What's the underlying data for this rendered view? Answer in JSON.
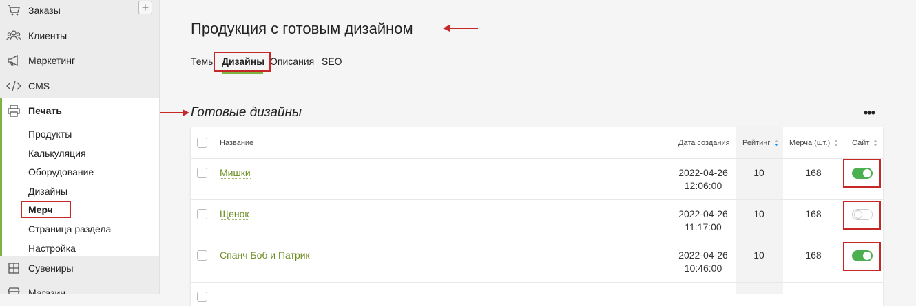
{
  "sidebar": {
    "items": [
      {
        "label": "Заказы",
        "icon": "cart-icon"
      },
      {
        "label": "Клиенты",
        "icon": "users-icon"
      },
      {
        "label": "Маркетинг",
        "icon": "megaphone-icon"
      },
      {
        "label": "CMS",
        "icon": "code-icon"
      },
      {
        "label": "Печать",
        "icon": "printer-icon"
      },
      {
        "label": "Сувениры",
        "icon": "box-icon"
      },
      {
        "label": "Магазин",
        "icon": "store-icon"
      }
    ],
    "add_label": "+",
    "print_subitems": [
      "Продукты",
      "Калькуляция",
      "Оборудование",
      "Дизайны",
      "Мерч",
      "Страница раздела",
      "Настройка"
    ]
  },
  "header": {
    "title": "Продукция с готовым дизайном"
  },
  "tabs": [
    "Темы",
    "Дизайны",
    "Описания",
    "SEO"
  ],
  "active_tab": "Дизайны",
  "section": {
    "title": "Готовые дизайны",
    "more_label": "•••"
  },
  "table": {
    "columns": [
      "Название",
      "Дата создания",
      "Рейтинг",
      "Мерча (шт.)",
      "Сайт"
    ],
    "rows": [
      {
        "name": "Мишки",
        "date": "2022-04-26",
        "time": "12:06:00",
        "rating": "10",
        "merch": "168",
        "site": true
      },
      {
        "name": "Щенок",
        "date": "2022-04-26",
        "time": "11:17:00",
        "rating": "10",
        "merch": "168",
        "site": false
      },
      {
        "name": "Спанч Боб и Патрик",
        "date": "2022-04-26",
        "time": "10:46:00",
        "rating": "10",
        "merch": "168",
        "site": true
      }
    ]
  },
  "colors": {
    "accent": "#7cb342",
    "link": "#6b8e23",
    "toggle_on": "#4caf50",
    "annotation": "#c62828"
  }
}
